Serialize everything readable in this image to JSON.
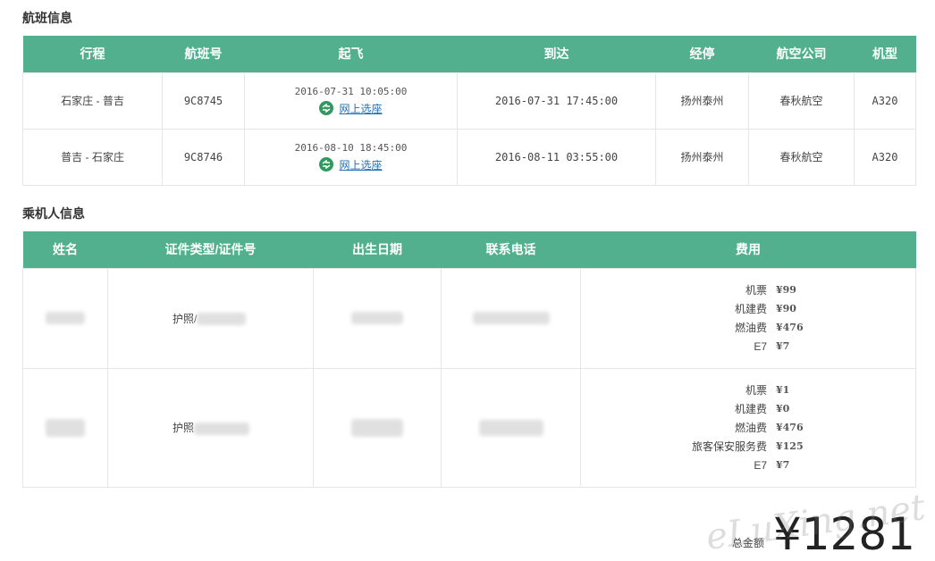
{
  "flight_section": {
    "title": "航班信息",
    "headers": [
      "行程",
      "航班号",
      "起飞",
      "到达",
      "经停",
      "航空公司",
      "机型"
    ],
    "rows": [
      {
        "route": "石家庄 - 普吉",
        "flight_no": "9C8745",
        "departure": "2016-07-31 10:05:00",
        "seat_link": "网上选座",
        "arrival": "2016-07-31 17:45:00",
        "stopover": "扬州泰州",
        "airline": "春秋航空",
        "aircraft": "A320"
      },
      {
        "route": "普吉 - 石家庄",
        "flight_no": "9C8746",
        "departure": "2016-08-10 18:45:00",
        "seat_link": "网上选座",
        "arrival": "2016-08-11 03:55:00",
        "stopover": "扬州泰州",
        "airline": "春秋航空",
        "aircraft": "A320"
      }
    ]
  },
  "passenger_section": {
    "title": "乘机人信息",
    "headers": [
      "姓名",
      "证件类型/证件号",
      "出生日期",
      "联系电话",
      "费用"
    ],
    "rows": [
      {
        "id_prefix": "护照/",
        "fees": [
          {
            "label": "机票",
            "value": "¥99"
          },
          {
            "label": "机建费",
            "value": "¥90"
          },
          {
            "label": "燃油费",
            "value": "¥476"
          },
          {
            "label": "E7",
            "value": "¥7"
          }
        ]
      },
      {
        "id_prefix": "护照",
        "fees": [
          {
            "label": "机票",
            "value": "¥1"
          },
          {
            "label": "机建费",
            "value": "¥0"
          },
          {
            "label": "燃油费",
            "value": "¥476"
          },
          {
            "label": "旅客保安服务费",
            "value": "¥125"
          },
          {
            "label": "E7",
            "value": "¥7"
          }
        ]
      }
    ]
  },
  "total": {
    "label": "总金额",
    "amount": "¥1281"
  },
  "watermark": "eLuXing.net",
  "colors": {
    "header_bg": "#52b08f",
    "link": "#1f6fb5",
    "seat_icon": "#2f9a5e"
  }
}
